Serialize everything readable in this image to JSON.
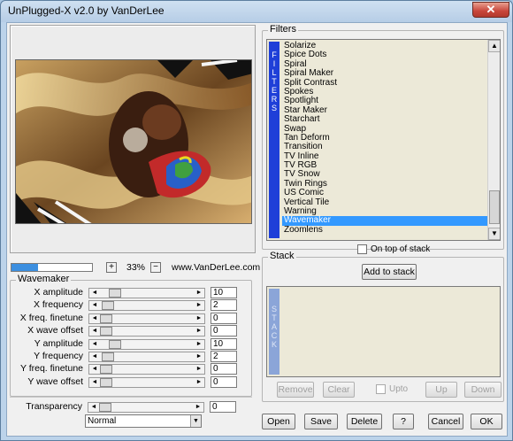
{
  "window": {
    "title": "UnPlugged-X v2.0 by VanDerLee",
    "close_glyph": "✕"
  },
  "filters": {
    "group_label": "Filters",
    "strip_label": "FILTERS",
    "items": [
      "Solarize",
      "Spice Dots",
      "Spiral",
      "Spiral Maker",
      "Split Contrast",
      "Spokes",
      "Spotlight",
      "Star Maker",
      "Starchart",
      "Swap",
      "Tan Deform",
      "Transition",
      "TV Inline",
      "TV RGB",
      "TV Snow",
      "Twin Rings",
      "US Comic",
      "Vertical Tile",
      "Warning",
      "Wavemaker",
      "Zoomlens"
    ],
    "selected": "Wavemaker",
    "on_top_label": "On top of stack"
  },
  "stack": {
    "group_label": "Stack",
    "strip_label": "STACK",
    "add_label": "Add to stack",
    "remove_label": "Remove",
    "clear_label": "Clear",
    "upto_label": "Upto",
    "up_label": "Up",
    "down_label": "Down"
  },
  "zoom": {
    "plus": "+",
    "minus": "−",
    "value": "33%",
    "progress": 0.33,
    "site": "www.VanDerLee.com"
  },
  "wavemaker": {
    "group_label": "Wavemaker",
    "params": [
      {
        "label": "X amplitude",
        "value": "10",
        "pos": 0.1
      },
      {
        "label": "X frequency",
        "value": "2",
        "pos": 0.02
      },
      {
        "label": "X freq. finetune",
        "value": "0",
        "pos": 0.0
      },
      {
        "label": "X wave offset",
        "value": "0",
        "pos": 0.0
      },
      {
        "label": "Y amplitude",
        "value": "10",
        "pos": 0.1
      },
      {
        "label": "Y frequency",
        "value": "2",
        "pos": 0.02
      },
      {
        "label": "Y freq. finetune",
        "value": "0",
        "pos": 0.0
      },
      {
        "label": "Y wave offset",
        "value": "0",
        "pos": 0.0
      }
    ],
    "transparency": {
      "label": "Transparency",
      "value": "0",
      "pos": 0.0
    },
    "blend_mode": "Normal"
  },
  "actions": {
    "open": "Open",
    "save": "Save",
    "delete": "Delete",
    "help": "?",
    "cancel": "Cancel",
    "ok": "OK"
  },
  "icons": {
    "left": "◄",
    "right": "►",
    "up": "▲",
    "down": "▼"
  }
}
